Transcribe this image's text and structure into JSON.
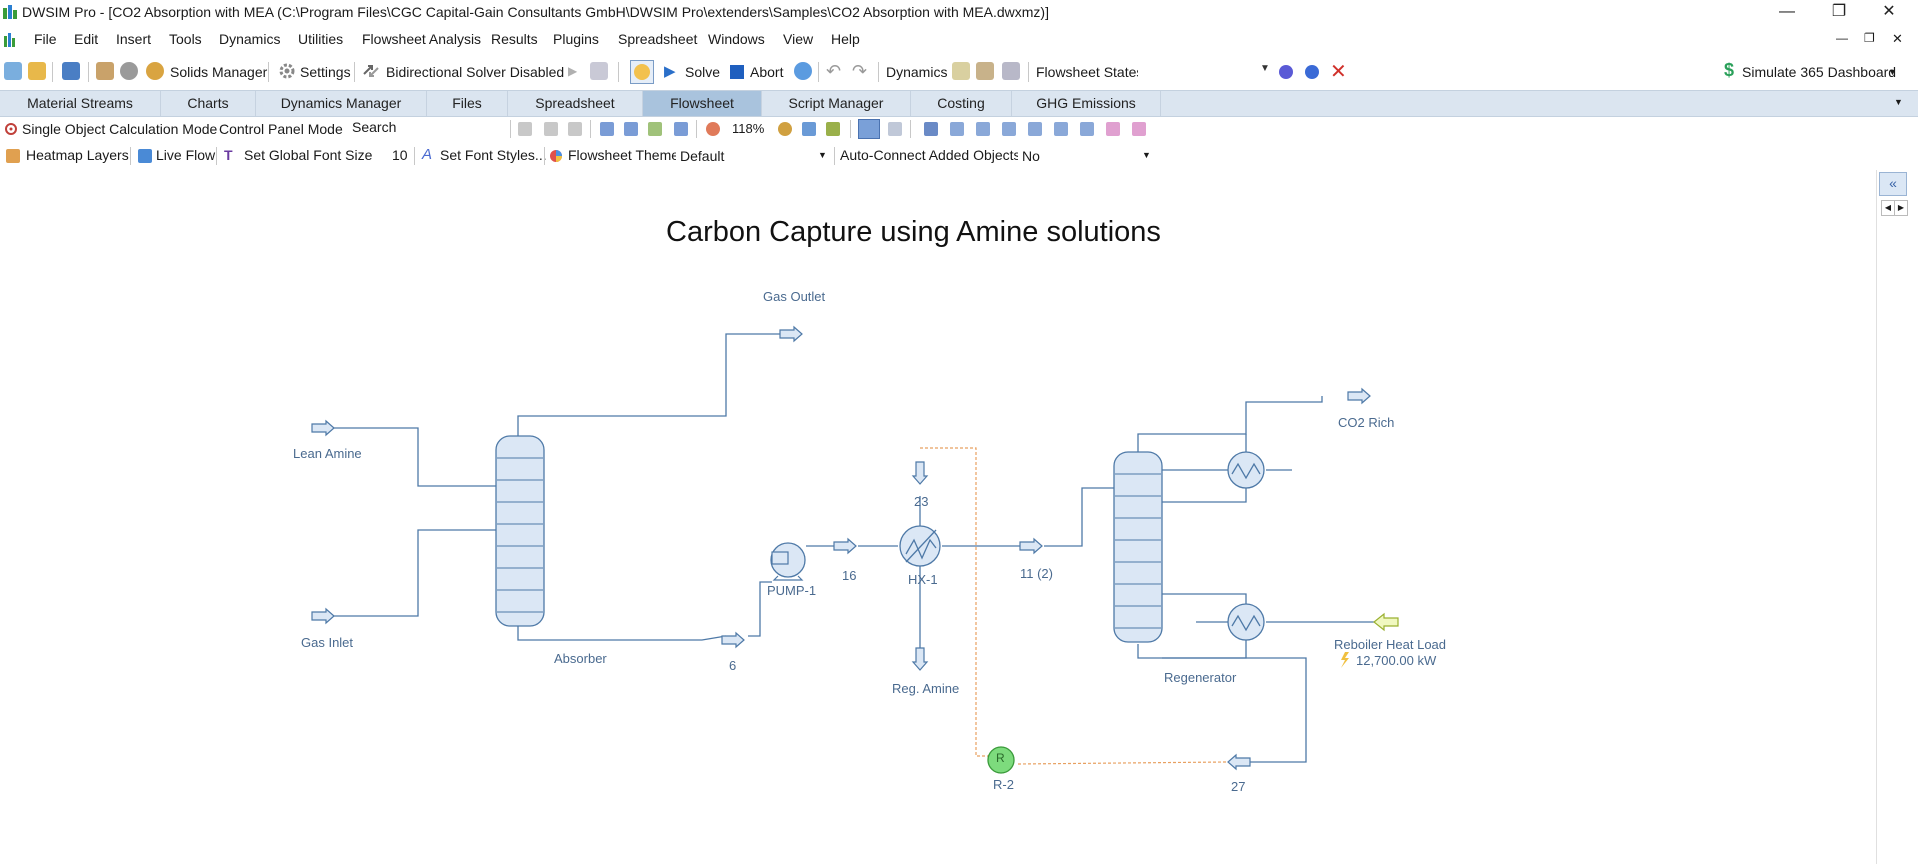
{
  "window": {
    "title": "DWSIM Pro - [CO2 Absorption with MEA (C:\\Program Files\\CGC Capital-Gain Consultants GmbH\\DWSIM Pro\\extenders\\Samples\\CO2 Absorption with MEA.dwxmz)]",
    "minimize": "—",
    "restore": "❐",
    "close": "✕"
  },
  "menu": {
    "items": [
      "File",
      "Edit",
      "Insert",
      "Tools",
      "Dynamics",
      "Utilities",
      "Flowsheet Analysis",
      "Results",
      "Plugins",
      "Spreadsheet",
      "Windows",
      "View",
      "Help"
    ],
    "mdi_min": "—",
    "mdi_restore": "❐",
    "mdi_close": "✕"
  },
  "toolbar": {
    "solids_manager": "Solids Manager",
    "settings": "Settings",
    "bidirectional": "Bidirectional Solver Disabled",
    "solve": "Solve",
    "abort": "Abort",
    "dynamics": "Dynamics",
    "flowsheet_states": "Flowsheet States",
    "simulate_dashboard": "Simulate 365 Dashboard"
  },
  "tabs": [
    "Material Streams",
    "Charts",
    "Dynamics Manager",
    "Files",
    "Spreadsheet",
    "Flowsheet",
    "Script Manager",
    "Costing",
    "GHG Emissions"
  ],
  "active_tab": "Flowsheet",
  "row3": {
    "single_object": "Single Object Calculation Mode",
    "control_panel": "Control Panel Mode",
    "search": "Search",
    "zoom": "118%"
  },
  "row4": {
    "heatmap": "Heatmap Layers",
    "live_flow": "Live Flow",
    "set_font_size": "Set Global Font Size",
    "font_size_value": "10",
    "set_font_styles": "Set Font Styles...",
    "flowsheet_theme": "Flowsheet Theme",
    "theme_value": "Default",
    "auto_connect": "Auto-Connect Added Objects",
    "auto_connect_value": "No"
  },
  "flowsheet": {
    "title": "Carbon Capture using Amine solutions",
    "labels": {
      "gas_outlet": "Gas Outlet",
      "lean_amine": "Lean Amine",
      "gas_inlet": "Gas Inlet",
      "absorber": "Absorber",
      "stream_6": "6",
      "pump": "PUMP-1",
      "stream_16": "16",
      "stream_23": "23",
      "hx": "HX-1",
      "reg_amine": "Reg. Amine",
      "stream_11": "11 (2)",
      "co2_rich": "CO2 Rich",
      "regenerator": "Regenerator",
      "reboiler_heat_load": "Reboiler Heat Load",
      "reboiler_value": "12,700.00 kW",
      "recycle": "R-2",
      "recycle_letter": "R",
      "stream_27": "27"
    }
  },
  "colors": {
    "tab_bg": "#dbe5f0",
    "tab_active": "#a9c3dd",
    "pfd_stroke": "#4e79a7",
    "pfd_fill": "#dbe7f5",
    "label": "#4a6a8f",
    "recycle_line": "#e8a060",
    "recycle_fill": "#7ddb7d"
  }
}
